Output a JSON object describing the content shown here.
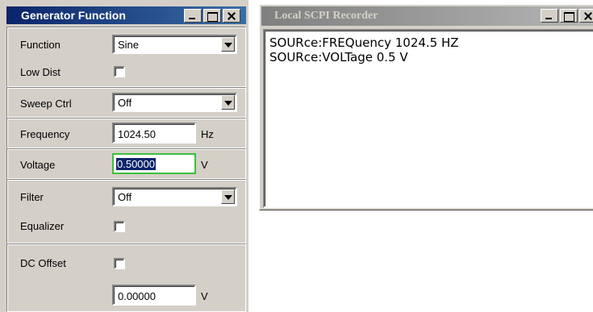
{
  "generator": {
    "title": "Generator Function",
    "function": {
      "label": "Function",
      "value": "Sine"
    },
    "low_dist": {
      "label": "Low Dist",
      "checked": false
    },
    "sweep_ctrl": {
      "label": "Sweep Ctrl",
      "value": "Off"
    },
    "frequency": {
      "label": "Frequency",
      "value": "1024.50",
      "unit": "Hz"
    },
    "voltage": {
      "label": "Voltage",
      "value": "0.50000",
      "unit": "V"
    },
    "filter": {
      "label": "Filter",
      "value": "Off"
    },
    "equalizer": {
      "label": "Equalizer",
      "checked": false
    },
    "dc_offset": {
      "label": "DC Offset",
      "checked": false,
      "value": "0.00000",
      "unit": "V"
    }
  },
  "scpi_recorder": {
    "title": "Local SCPI Recorder",
    "lines": [
      "SOURce:FREQuency 1024.5 HZ",
      "SOURce:VOLTage 0.5 V"
    ]
  },
  "colors": {
    "active_title_start": "#0a246a",
    "active_title_end": "#3a6ea5",
    "inactive_title": "#808080",
    "panel_bg": "#d4d0c8",
    "focus_border": "#3cbf3c"
  }
}
